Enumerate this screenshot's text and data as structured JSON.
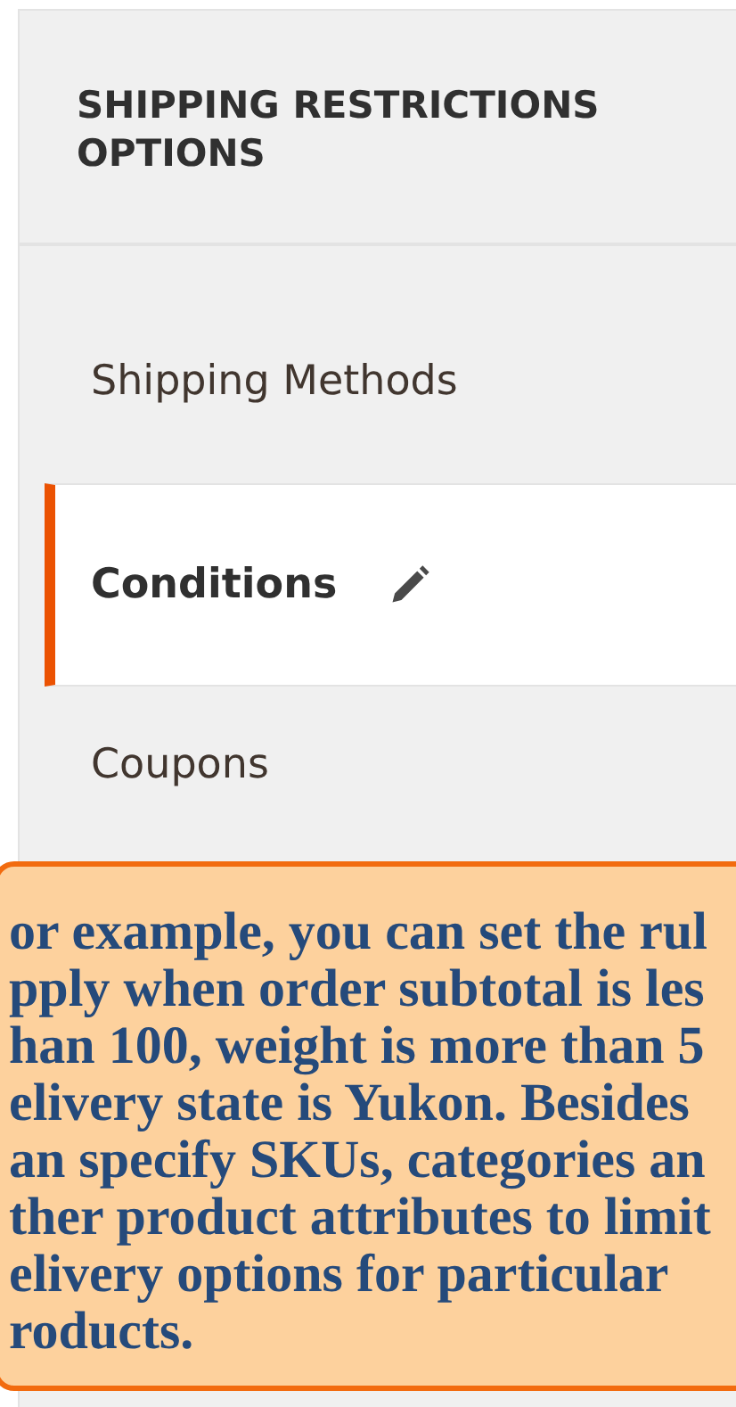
{
  "panel": {
    "title": "SHIPPING RESTRICTIONS OPTIONS"
  },
  "nav_items": [
    {
      "label": "Shipping Methods",
      "selected": false,
      "editing": false
    },
    {
      "label": "Conditions",
      "selected": true,
      "editing": true
    },
    {
      "label": "Coupons",
      "selected": false,
      "editing": false
    }
  ],
  "callout": {
    "lines": [
      "or example, you can set the rul",
      "pply when order subtotal is les",
      "han 100, weight is more than 5",
      "elivery state is Yukon. Besides",
      "an specify SKUs, categories an",
      "ther product attributes to limit",
      "elivery options for particular",
      "roducts."
    ]
  }
}
